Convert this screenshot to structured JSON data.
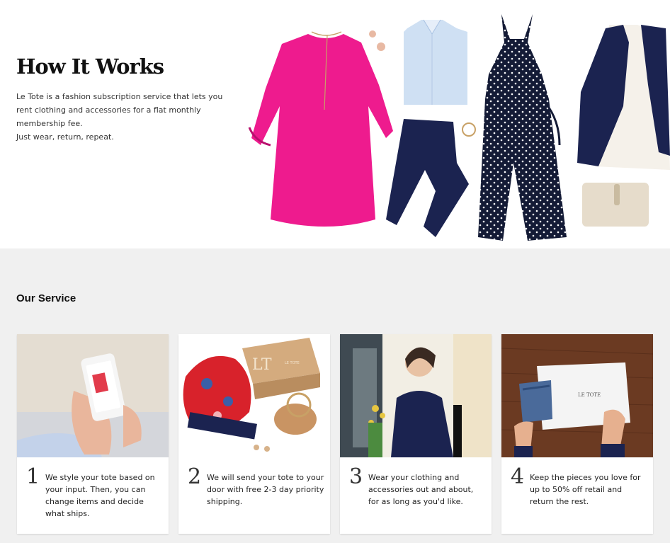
{
  "hero": {
    "title": "How It Works",
    "description_line1": "Le Tote is a fashion subscription service that lets you rent clothing and accessories for a flat monthly membership fee.",
    "description_line2": "Just wear, return, repeat.",
    "box_logo": "LT",
    "box_brand": "LE TOTE"
  },
  "service": {
    "title": "Our Service",
    "steps": [
      {
        "number": "1",
        "text": "We style your tote based on your input. Then, you can change items and decide what ships."
      },
      {
        "number": "2",
        "text": "We will send your tote to your door with free 2-3 day priority shipping."
      },
      {
        "number": "3",
        "text": "Wear your clothing and accessories out and about, for as long as you'd like."
      },
      {
        "number": "4",
        "text": "Keep the pieces you love for up to 50% off retail and return the rest."
      }
    ],
    "bag_label": "LE TOTE"
  },
  "colors": {
    "page_bg": "#f0f0f0",
    "dress_pink": "#ee1b8e",
    "navy": "#1b2350",
    "shirt_blue": "#cfe0f3"
  }
}
